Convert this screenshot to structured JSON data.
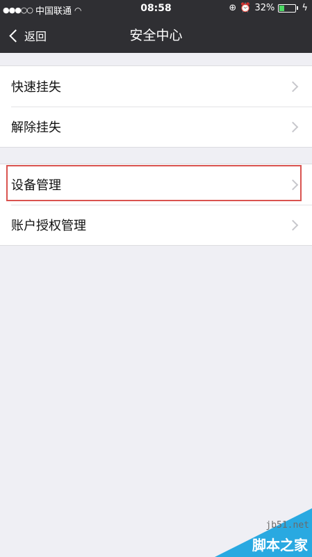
{
  "status_bar": {
    "carrier": "中国联通",
    "time": "08:58",
    "battery_percent_text": "32%",
    "battery_level": 0.32
  },
  "nav": {
    "back_label": "返回",
    "title": "安全中心"
  },
  "groups": [
    {
      "items": [
        {
          "label": "快速挂失"
        },
        {
          "label": "解除挂失"
        }
      ]
    },
    {
      "items": [
        {
          "label": "设备管理"
        },
        {
          "label": "账户授权管理"
        }
      ]
    }
  ],
  "watermark": {
    "url": "jb51.net",
    "name": "脚本之家"
  },
  "colors": {
    "bar": "#2f2f33",
    "background": "#efeff4",
    "highlight": "#d9534f",
    "watermark": "#29a9e1"
  }
}
